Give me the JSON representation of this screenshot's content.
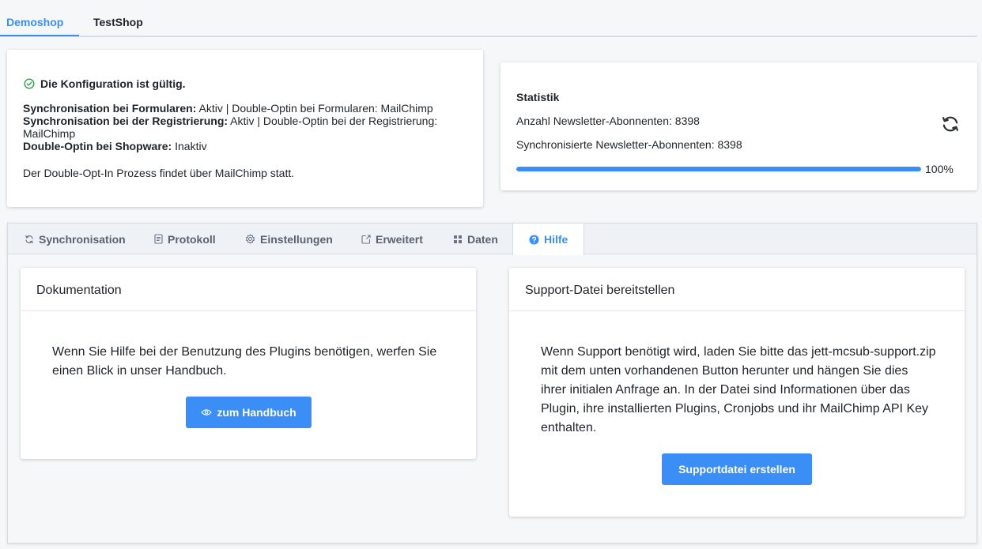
{
  "shop_tabs": [
    {
      "label": "Demoshop",
      "active": true
    },
    {
      "label": "TestShop",
      "active": false
    }
  ],
  "config": {
    "status": "Die Konfiguration ist gültig.",
    "lines": [
      {
        "label": "Synchronisation bei Formularen:",
        "value": " Aktiv | Double-Optin bei Formularen: MailChimp"
      },
      {
        "label": "Synchronisation bei der Registrierung:",
        "value": " Aktiv | Double-Optin bei der Registrierung: MailChimp"
      },
      {
        "label": "Double-Optin bei Shopware:",
        "value": " Inaktiv"
      }
    ],
    "note": "Der Double-Opt-In Prozess findet über MailChimp statt."
  },
  "statistik": {
    "title": "Statistik",
    "subscribers": "Anzahl Newsletter-Abonnenten: 8398",
    "synced": "Synchronisierte Newsletter-Abonnenten: 8398",
    "progress": 100,
    "progress_label": "100%"
  },
  "tabs": [
    {
      "label": "Synchronisation",
      "icon": "sync-icon"
    },
    {
      "label": "Protokoll",
      "icon": "document-icon"
    },
    {
      "label": "Einstellungen",
      "icon": "gear-icon"
    },
    {
      "label": "Erweitert",
      "icon": "external-icon"
    },
    {
      "label": "Daten",
      "icon": "grid-icon"
    },
    {
      "label": "Hilfe",
      "icon": "help-icon",
      "active": true
    }
  ],
  "doc": {
    "title": "Dokumentation",
    "text": "Wenn Sie Hilfe bei der Benutzung des Plugins benötigen, werfen Sie einen Blick in unser Handbuch.",
    "button": "zum Handbuch"
  },
  "support": {
    "title": "Support-Datei bereitstellen",
    "text": "Wenn Support benötigt wird, laden Sie bitte das jett-mcsub-support.zip mit dem unten vorhandenen Button herunter und hängen Sie dies ihrer initialen Anfrage an. In der Datei sind Informationen über das Plugin, ihre installierten Plugins, Cronjobs und ihr MailChimp API Key enthalten.",
    "button": "Supportdatei erstellen"
  },
  "colors": {
    "accent": "#3a8ef6",
    "success": "#2ea44f"
  }
}
